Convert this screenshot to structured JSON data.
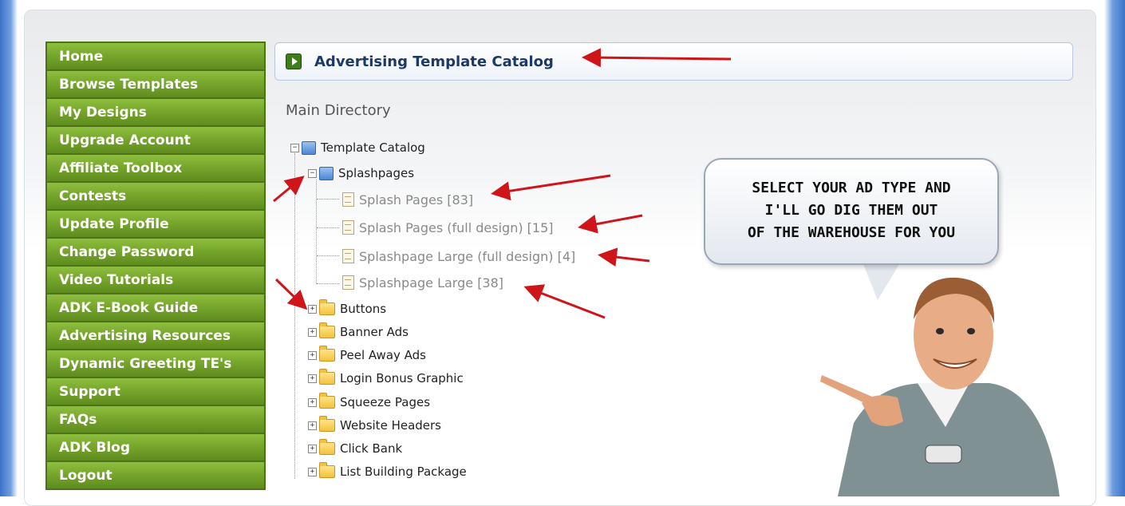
{
  "sidebar": {
    "items": [
      {
        "label": "Home"
      },
      {
        "label": "Browse Templates"
      },
      {
        "label": "My Designs"
      },
      {
        "label": "Upgrade Account"
      },
      {
        "label": "Affiliate Toolbox"
      },
      {
        "label": "Contests"
      },
      {
        "label": "Update Profile"
      },
      {
        "label": "Change Password"
      },
      {
        "label": "Video Tutorials"
      },
      {
        "label": "ADK E-Book Guide"
      },
      {
        "label": "Advertising Resources"
      },
      {
        "label": "Dynamic Greeting TE's"
      },
      {
        "label": "Support"
      },
      {
        "label": "FAQs"
      },
      {
        "label": "ADK Blog"
      },
      {
        "label": "Logout"
      }
    ]
  },
  "header": {
    "title": "Advertising Template Catalog"
  },
  "main": {
    "directory_title": "Main Directory",
    "tree": {
      "root": "Template Catalog",
      "expanded": "Splashpages",
      "children": [
        "Splash Pages [83]",
        "Splash Pages (full design) [15]",
        "Splashpage Large (full design) [4]",
        "Splashpage Large [38]"
      ],
      "folders": [
        "Buttons",
        "Banner Ads",
        "Peel Away Ads",
        "Login Bonus Graphic",
        "Squeeze Pages",
        "Website Headers",
        "Click Bank",
        "List Building Package"
      ]
    }
  },
  "bubble": {
    "lines": [
      "SELECT YOUR AD TYPE AND",
      "I'LL  GO DIG THEM OUT",
      "OF THE WAREHOUSE FOR YOU"
    ]
  },
  "colors": {
    "sidebar_green": "#76a72c",
    "arrow_red": "#d0151a",
    "header_text": "#1d3a66"
  }
}
